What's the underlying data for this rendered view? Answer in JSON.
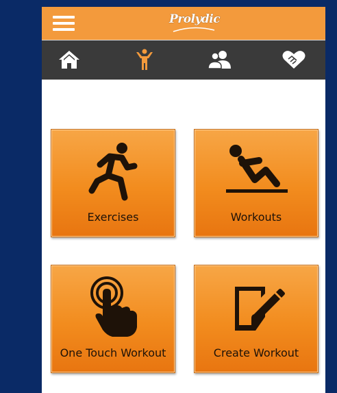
{
  "header": {
    "logo_text": "Prolydic",
    "menu_icon": "hamburger-menu-icon"
  },
  "nav": {
    "items": [
      {
        "icon": "home-icon",
        "active": false
      },
      {
        "icon": "fitness-person-icon",
        "active": true
      },
      {
        "icon": "users-icon",
        "active": false
      },
      {
        "icon": "heart-handshake-icon",
        "active": false
      }
    ]
  },
  "tiles": [
    {
      "label": "Exercises",
      "icon": "running-person-icon"
    },
    {
      "label": "Workouts",
      "icon": "situp-person-icon"
    },
    {
      "label": "One Touch Workout",
      "icon": "touch-finger-icon"
    },
    {
      "label": "Create Workout",
      "icon": "edit-note-icon"
    }
  ],
  "colors": {
    "background": "#0a2a66",
    "header": "#f39a3c",
    "navbar": "#3a3a3a",
    "tile": "#f28c1e",
    "active_nav": "#f39a3c"
  }
}
